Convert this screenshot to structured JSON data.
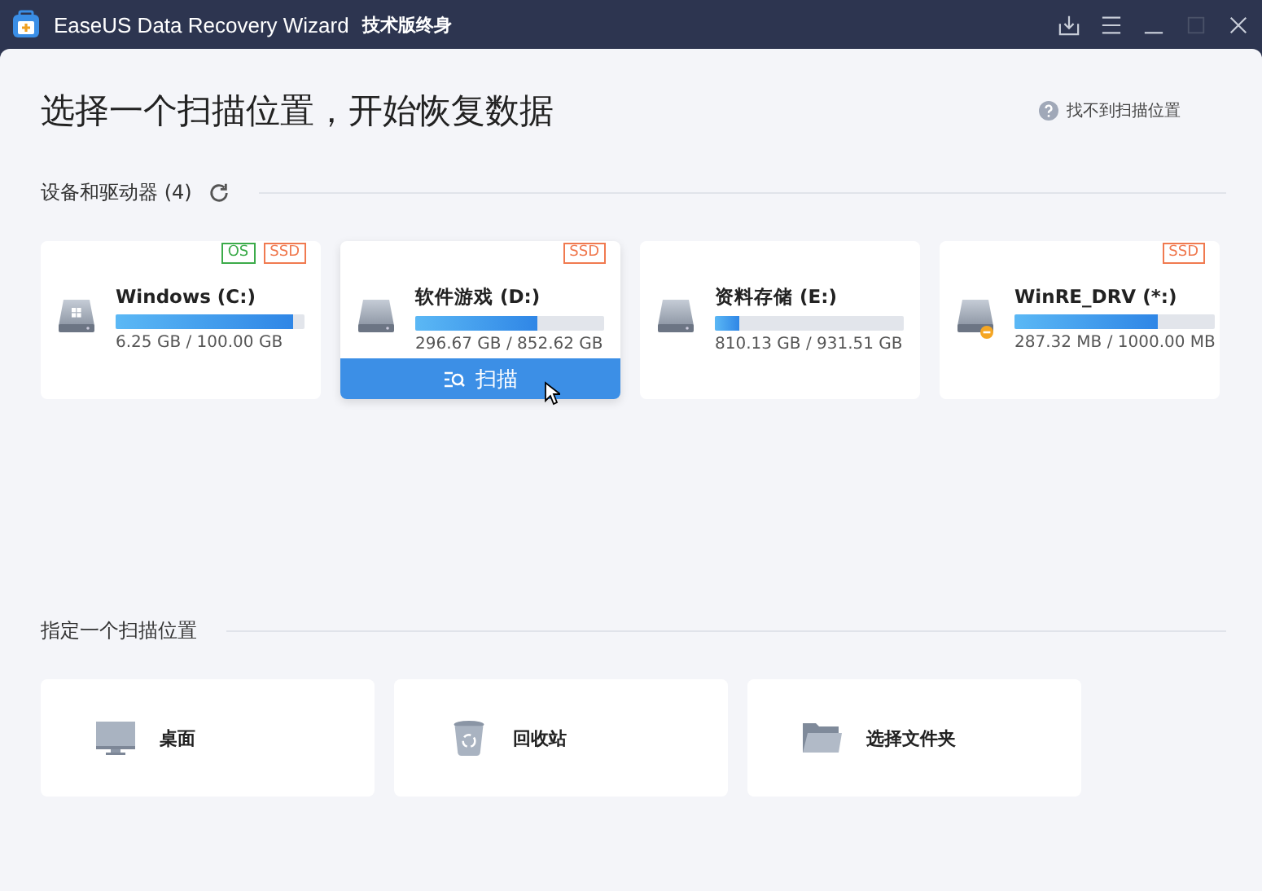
{
  "window": {
    "title": "EaseUS Data Recovery Wizard",
    "edition": "技术版终身"
  },
  "heading": "选择一个扫描位置，开始恢复数据",
  "help_link": "找不到扫描位置",
  "devices": {
    "title": "设备和驱动器 (4)",
    "drives": [
      {
        "name": "Windows (C:)",
        "usage": "6.25 GB / 100.00 GB",
        "level": 0.94,
        "kind": "system",
        "tags": [
          {
            "label": "OS",
            "kind": "os"
          },
          {
            "label": "SSD",
            "kind": "ssd"
          }
        ],
        "selected": false
      },
      {
        "name": "软件游戏 (D:)",
        "usage": "296.67 GB / 852.62 GB",
        "level": 0.65,
        "kind": "disk",
        "tags": [
          {
            "label": "SSD",
            "kind": "ssd"
          }
        ],
        "selected": true,
        "scan_label": "扫描"
      },
      {
        "name": "资料存储 (E:)",
        "usage": "810.13 GB / 931.51 GB",
        "level": 0.13,
        "kind": "disk",
        "selected": false
      },
      {
        "name": "WinRE_DRV (*:)",
        "usage": "287.32 MB / 1000.00 MB",
        "level": 0.71,
        "kind": "warning",
        "tags": [
          {
            "label": "SSD",
            "kind": "ssd"
          }
        ],
        "selected": false
      }
    ]
  },
  "locations": {
    "title": "指定一个扫描位置",
    "items": [
      {
        "label": "桌面",
        "kind": "desktop"
      },
      {
        "label": "回收站",
        "kind": "recycle"
      },
      {
        "label": "选择文件夹",
        "kind": "folder"
      }
    ]
  }
}
